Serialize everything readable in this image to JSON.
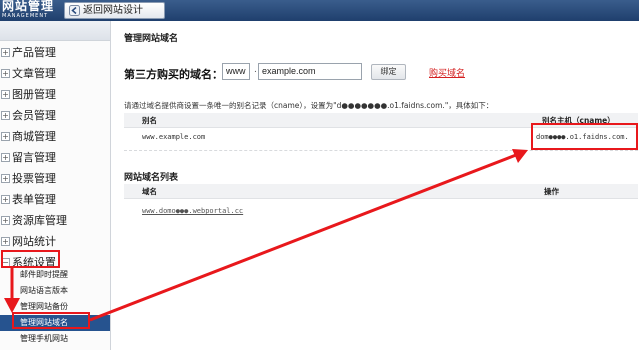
{
  "topbar": {
    "logo_line1": "网站管理",
    "logo_line2": "MANAGEMENT",
    "back_button": "返回网站设计"
  },
  "sidebar": {
    "items": [
      {
        "label": "产品管理"
      },
      {
        "label": "文章管理"
      },
      {
        "label": "图册管理"
      },
      {
        "label": "会员管理"
      },
      {
        "label": "商城管理"
      },
      {
        "label": "留言管理"
      },
      {
        "label": "投票管理"
      },
      {
        "label": "表单管理"
      },
      {
        "label": "资源库管理"
      },
      {
        "label": "网站统计"
      },
      {
        "label": "系统设置"
      }
    ],
    "subitems": [
      {
        "label": "邮件即时提醒"
      },
      {
        "label": "网站语言版本"
      },
      {
        "label": "管理网站备份"
      },
      {
        "label": "管理网站域名",
        "active": true
      },
      {
        "label": "管理手机网站"
      }
    ]
  },
  "main": {
    "title": "管理网站域名",
    "domain_form": {
      "label": "第三方购买的域名：",
      "www_value": "www",
      "separator": ".",
      "domain_value": "example.com",
      "bind_button": "绑定",
      "buy_link": "购买域名"
    },
    "instruction": "请通过域名提供商设置一条唯一的别名记录（cname），设置为\"d●●●●●●●.o1.faidns.com.\"，具体如下：",
    "cname_table": {
      "headers": [
        "别名",
        "别名主机（cname）"
      ],
      "row": [
        "www.example.com",
        "dom●●●●.o1.faidns.com."
      ]
    },
    "list_title": "网站域名列表",
    "domain_table": {
      "headers": [
        "域名",
        "操作"
      ],
      "site": "www.domo●●●.webportal.cc"
    }
  },
  "colors": {
    "topbar": "#2b4c7e",
    "active_nav": "#26538f",
    "highlight": "#e8181c",
    "buy_link": "#d42020"
  }
}
